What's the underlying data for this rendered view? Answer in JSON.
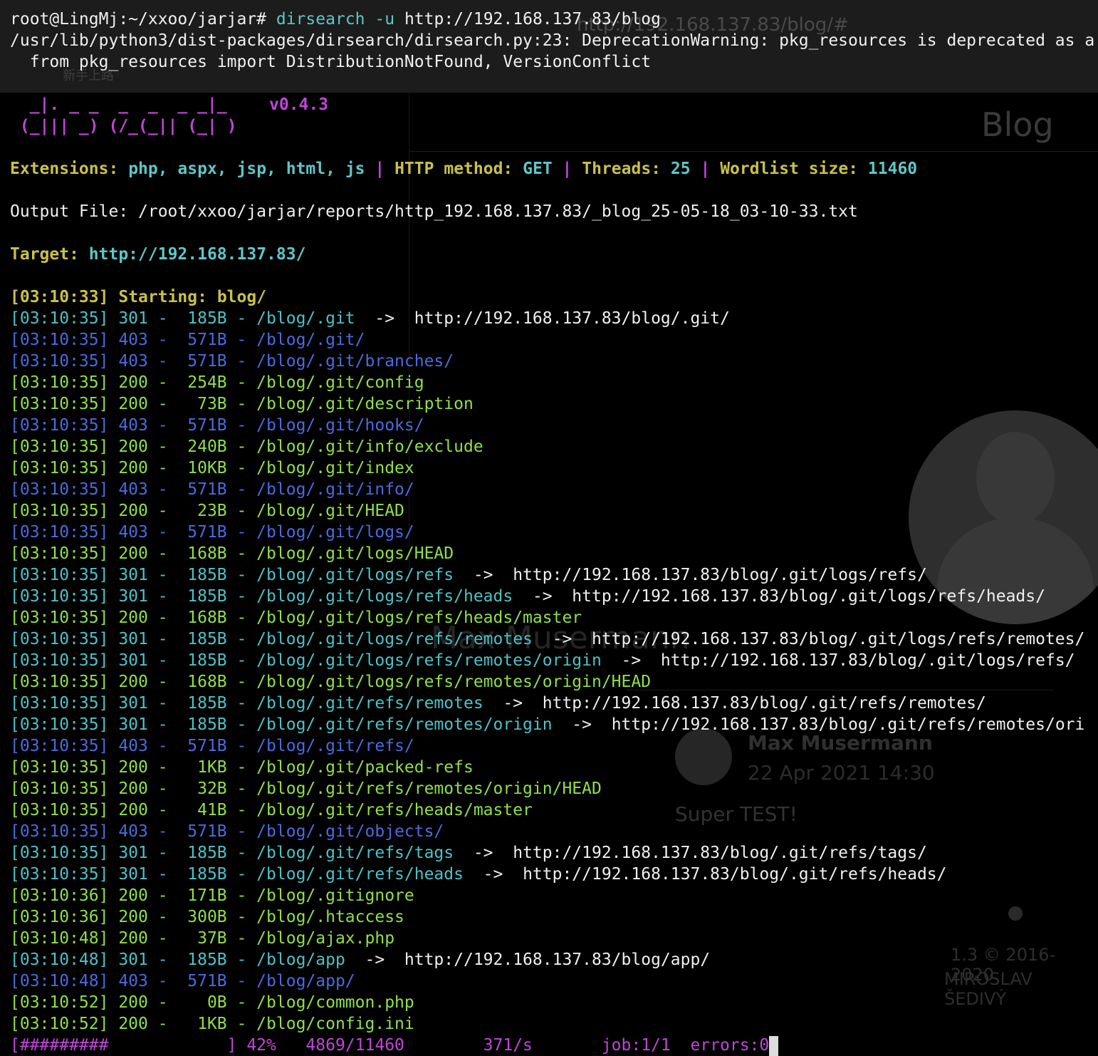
{
  "background": {
    "url": "http://192.168.137.83/blog/#",
    "tab": "新手上路",
    "blog_title": "Blog",
    "author_large": "Max Musermann",
    "author": "Max Musermann",
    "date": "22 Apr 2021 14:30",
    "post": "Super TEST!",
    "footer_version": "1.3 © 2016-2020",
    "footer_author": "MIROSLAV ŠEDIVÝ"
  },
  "prompt": "root@LingMj:~/xxoo/jarjar#",
  "command": {
    "bin": "dirsearch",
    "flag": "-u",
    "arg": "http://192.168.137.83/blog"
  },
  "warning_line1": "/usr/lib/python3/dist-packages/dirsearch/dirsearch.py:23: DeprecationWarning: pkg_resources is deprecated as a",
  "warning_line2": "  from pkg_resources import DistributionNotFound, VersionConflict",
  "banner_line1": "  _|. _ _  _  _  _ _|_",
  "banner_line2": " (_||| _) (/_(_|| (_| )",
  "version": "v0.4.3",
  "config": {
    "extensions_label": "Extensions:",
    "extensions": "php, aspx, jsp, html, js",
    "sep": "|",
    "method_label": "HTTP method:",
    "method": "GET",
    "threads_label": "Threads:",
    "threads": "25",
    "wordlist_label": "Wordlist size:",
    "wordlist": "11460"
  },
  "output_file": "Output File: /root/xxoo/jarjar/reports/http_192.168.137.83/_blog_25-05-18_03-10-33.txt",
  "target_label": "Target:",
  "target": "http://192.168.137.83/",
  "start_time": "[03:10:33]",
  "start_text": "Starting: blog/",
  "results": [
    {
      "t": "[03:10:35]",
      "code": "301",
      "size": "185B",
      "path": "/blog/.git",
      "redirect": "http://192.168.137.83/blog/.git/",
      "color": "cy"
    },
    {
      "t": "[03:10:35]",
      "code": "403",
      "size": "571B",
      "path": "/blog/.git/",
      "redirect": "",
      "color": "b"
    },
    {
      "t": "[03:10:35]",
      "code": "403",
      "size": "571B",
      "path": "/blog/.git/branches/",
      "redirect": "",
      "color": "b"
    },
    {
      "t": "[03:10:35]",
      "code": "200",
      "size": "254B",
      "path": "/blog/.git/config",
      "redirect": "",
      "color": "g"
    },
    {
      "t": "[03:10:35]",
      "code": "200",
      "size": "73B",
      "path": "/blog/.git/description",
      "redirect": "",
      "color": "g"
    },
    {
      "t": "[03:10:35]",
      "code": "403",
      "size": "571B",
      "path": "/blog/.git/hooks/",
      "redirect": "",
      "color": "b"
    },
    {
      "t": "[03:10:35]",
      "code": "200",
      "size": "240B",
      "path": "/blog/.git/info/exclude",
      "redirect": "",
      "color": "g"
    },
    {
      "t": "[03:10:35]",
      "code": "200",
      "size": "10KB",
      "path": "/blog/.git/index",
      "redirect": "",
      "color": "g"
    },
    {
      "t": "[03:10:35]",
      "code": "403",
      "size": "571B",
      "path": "/blog/.git/info/",
      "redirect": "",
      "color": "b"
    },
    {
      "t": "[03:10:35]",
      "code": "200",
      "size": "23B",
      "path": "/blog/.git/HEAD",
      "redirect": "",
      "color": "g"
    },
    {
      "t": "[03:10:35]",
      "code": "403",
      "size": "571B",
      "path": "/blog/.git/logs/",
      "redirect": "",
      "color": "b"
    },
    {
      "t": "[03:10:35]",
      "code": "200",
      "size": "168B",
      "path": "/blog/.git/logs/HEAD",
      "redirect": "",
      "color": "g"
    },
    {
      "t": "[03:10:35]",
      "code": "301",
      "size": "185B",
      "path": "/blog/.git/logs/refs",
      "redirect": "http://192.168.137.83/blog/.git/logs/refs/",
      "color": "cy"
    },
    {
      "t": "[03:10:35]",
      "code": "301",
      "size": "185B",
      "path": "/blog/.git/logs/refs/heads",
      "redirect": "http://192.168.137.83/blog/.git/logs/refs/heads/",
      "color": "cy"
    },
    {
      "t": "[03:10:35]",
      "code": "200",
      "size": "168B",
      "path": "/blog/.git/logs/refs/heads/master",
      "redirect": "",
      "color": "g"
    },
    {
      "t": "[03:10:35]",
      "code": "301",
      "size": "185B",
      "path": "/blog/.git/logs/refs/remotes",
      "redirect": "http://192.168.137.83/blog/.git/logs/refs/remotes/",
      "color": "cy"
    },
    {
      "t": "[03:10:35]",
      "code": "301",
      "size": "185B",
      "path": "/blog/.git/logs/refs/remotes/origin",
      "redirect": "http://192.168.137.83/blog/.git/logs/refs/",
      "color": "cy"
    },
    {
      "t": "[03:10:35]",
      "code": "200",
      "size": "168B",
      "path": "/blog/.git/logs/refs/remotes/origin/HEAD",
      "redirect": "",
      "color": "g"
    },
    {
      "t": "[03:10:35]",
      "code": "301",
      "size": "185B",
      "path": "/blog/.git/refs/remotes",
      "redirect": "http://192.168.137.83/blog/.git/refs/remotes/",
      "color": "cy"
    },
    {
      "t": "[03:10:35]",
      "code": "301",
      "size": "185B",
      "path": "/blog/.git/refs/remotes/origin",
      "redirect": "http://192.168.137.83/blog/.git/refs/remotes/ori",
      "color": "cy"
    },
    {
      "t": "[03:10:35]",
      "code": "403",
      "size": "571B",
      "path": "/blog/.git/refs/",
      "redirect": "",
      "color": "b"
    },
    {
      "t": "[03:10:35]",
      "code": "200",
      "size": "1KB",
      "path": "/blog/.git/packed-refs",
      "redirect": "",
      "color": "g"
    },
    {
      "t": "[03:10:35]",
      "code": "200",
      "size": "32B",
      "path": "/blog/.git/refs/remotes/origin/HEAD",
      "redirect": "",
      "color": "g"
    },
    {
      "t": "[03:10:35]",
      "code": "200",
      "size": "41B",
      "path": "/blog/.git/refs/heads/master",
      "redirect": "",
      "color": "g"
    },
    {
      "t": "[03:10:35]",
      "code": "403",
      "size": "571B",
      "path": "/blog/.git/objects/",
      "redirect": "",
      "color": "b"
    },
    {
      "t": "[03:10:35]",
      "code": "301",
      "size": "185B",
      "path": "/blog/.git/refs/tags",
      "redirect": "http://192.168.137.83/blog/.git/refs/tags/",
      "color": "cy"
    },
    {
      "t": "[03:10:35]",
      "code": "301",
      "size": "185B",
      "path": "/blog/.git/refs/heads",
      "redirect": "http://192.168.137.83/blog/.git/refs/heads/",
      "color": "cy"
    },
    {
      "t": "[03:10:36]",
      "code": "200",
      "size": "171B",
      "path": "/blog/.gitignore",
      "redirect": "",
      "color": "g"
    },
    {
      "t": "[03:10:36]",
      "code": "200",
      "size": "300B",
      "path": "/blog/.htaccess",
      "redirect": "",
      "color": "g"
    },
    {
      "t": "[03:10:48]",
      "code": "200",
      "size": "37B",
      "path": "/blog/ajax.php",
      "redirect": "",
      "color": "g"
    },
    {
      "t": "[03:10:48]",
      "code": "301",
      "size": "185B",
      "path": "/blog/app",
      "redirect": "http://192.168.137.83/blog/app/",
      "color": "cy"
    },
    {
      "t": "[03:10:48]",
      "code": "403",
      "size": "571B",
      "path": "/blog/app/",
      "redirect": "",
      "color": "b"
    },
    {
      "t": "[03:10:52]",
      "code": "200",
      "size": "0B",
      "path": "/blog/common.php",
      "redirect": "",
      "color": "g"
    },
    {
      "t": "[03:10:52]",
      "code": "200",
      "size": "1KB",
      "path": "/blog/config.ini",
      "redirect": "",
      "color": "g"
    }
  ],
  "progress_line": "[#########            ] 42%   4869/11460        371/s       job:1/1  errors:0"
}
